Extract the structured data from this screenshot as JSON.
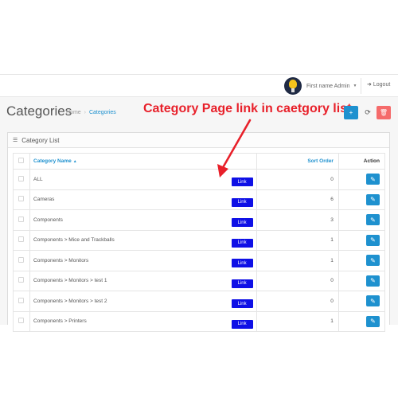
{
  "header": {
    "user_name": "First name Admin",
    "logout_label": "Logout",
    "caret": "▼"
  },
  "page": {
    "title": "Categories",
    "breadcrumb_home": "Home",
    "breadcrumb_sep": "›",
    "breadcrumb_current": "Categories",
    "annotation": "Category Page link in caetgory list"
  },
  "panel": {
    "heading": "Category List",
    "columns": {
      "name": "Category Name",
      "sort_order": "Sort Order",
      "action": "Action"
    },
    "link_label": "Link",
    "rows": [
      {
        "name": "ALL",
        "sort_order": "0"
      },
      {
        "name": "Cameras",
        "sort_order": "6"
      },
      {
        "name": "Components",
        "sort_order": "3"
      },
      {
        "name": "Components  >  Mice and Trackballs",
        "sort_order": "1"
      },
      {
        "name": "Components  >  Monitors",
        "sort_order": "1"
      },
      {
        "name": "Components  >  Monitors  >  test 1",
        "sort_order": "0"
      },
      {
        "name": "Components  >  Monitors  >  test 2",
        "sort_order": "0"
      },
      {
        "name": "Components  >  Printers",
        "sort_order": "1"
      }
    ]
  },
  "icons": {
    "user": "user-avatar",
    "logout": "sign-out-icon",
    "list": "list-icon",
    "add": "plus-icon",
    "refresh": "refresh-icon",
    "delete": "trash-icon",
    "edit": "pencil-icon"
  },
  "colors": {
    "primary": "#1e91cf",
    "danger": "#f56b6b",
    "annotation": "#e8202a",
    "link_button": "#0f10e6"
  }
}
